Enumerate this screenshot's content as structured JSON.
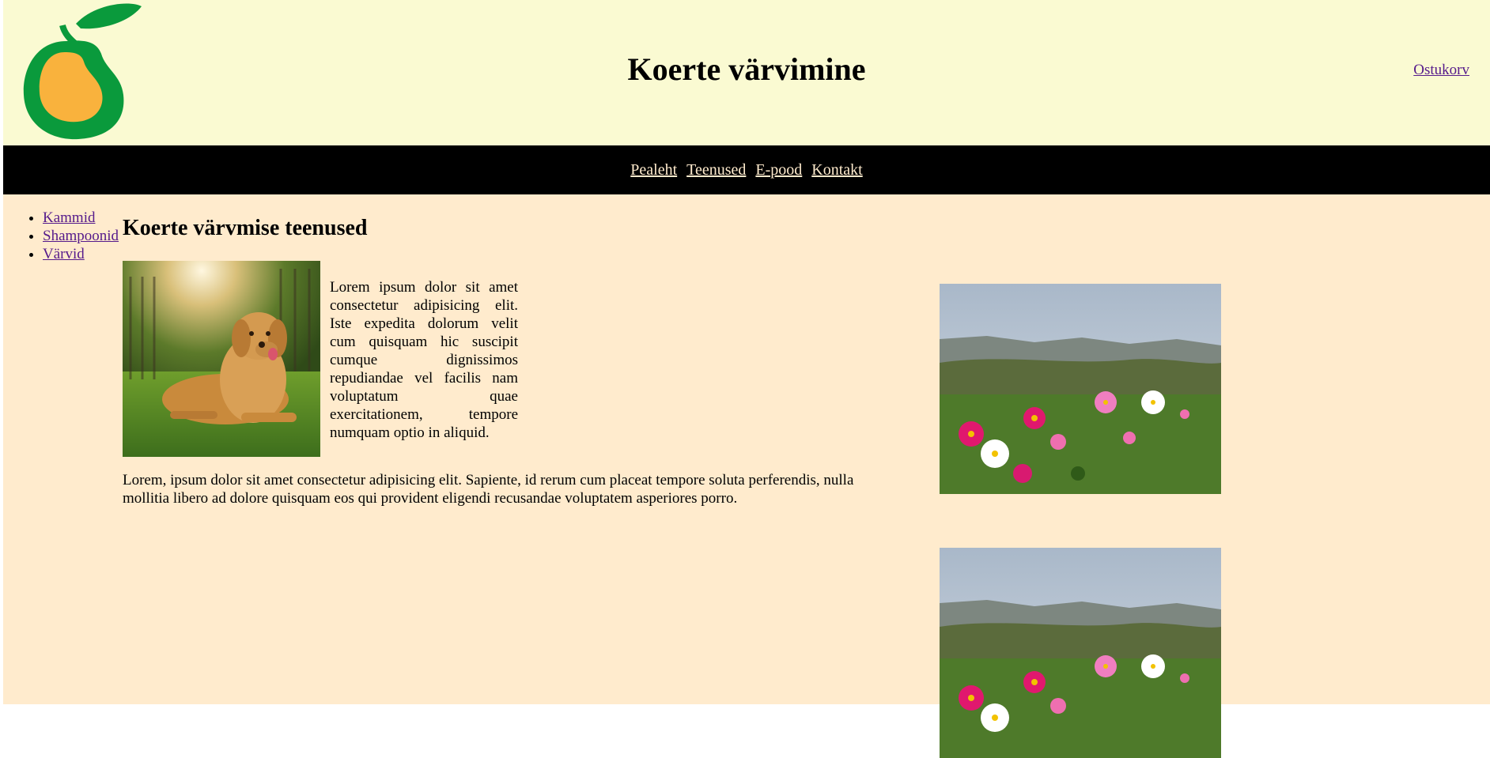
{
  "header": {
    "title": "Koerte värvimine",
    "cart_link": "Ostukorv",
    "logo_name": "pear-logo"
  },
  "nav": {
    "items": [
      "Pealeht",
      "Teenused",
      "E-pood",
      "Kontakt"
    ]
  },
  "sidebar": {
    "items": [
      "Kammid",
      "Shampoonid",
      "Värvid"
    ]
  },
  "main": {
    "heading": "Koerte värvmise teenused",
    "intro": "Lorem ipsum dolor sit amet consectetur adipisicing elit. Iste expedita dolorum velit cum quisquam hic suscipit cumque dignissimos repudiandae vel facilis nam voluptatum quae exercitationem, tempore numquam optio in aliquid.",
    "paragraph": "Lorem, ipsum dolor sit amet consectetur adipisicing elit. Sapiente, id rerum cum placeat tempore soluta perferendis, nulla mollitia libero ad dolore quisquam eos qui provident eligendi recusandae voluptatem asperiores porro."
  },
  "colors": {
    "header_bg": "#fafad2",
    "page_bg": "#ffebcd",
    "nav_bg": "#000000",
    "nav_link": "#ffebcd",
    "logo_green": "#0a9a3c",
    "logo_orange": "#f9b23d"
  }
}
